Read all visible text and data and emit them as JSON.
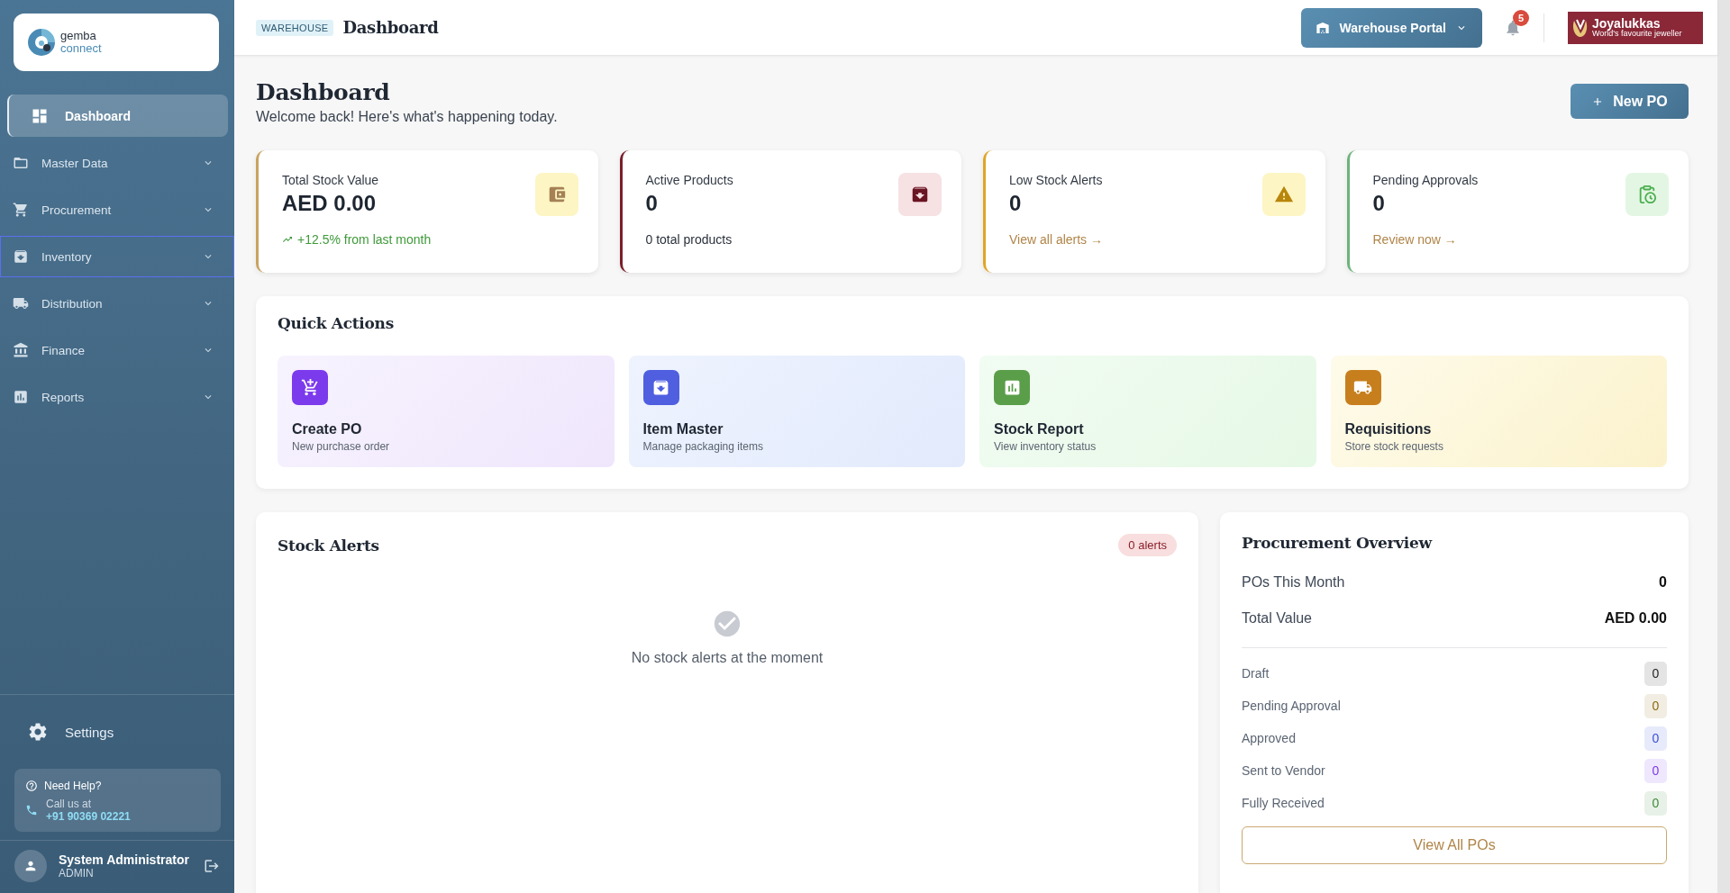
{
  "sidebar": {
    "logo": {
      "line1": "gemba",
      "line2": "connect"
    },
    "nav": [
      {
        "label": "Dashboard",
        "kind": "link",
        "selected": true,
        "focused": false
      },
      {
        "label": "Master Data",
        "kind": "group",
        "selected": false,
        "focused": false
      },
      {
        "label": "Procurement",
        "kind": "group",
        "selected": false,
        "focused": false
      },
      {
        "label": "Inventory",
        "kind": "group",
        "selected": false,
        "focused": true
      },
      {
        "label": "Distribution",
        "kind": "group",
        "selected": false,
        "focused": false
      },
      {
        "label": "Finance",
        "kind": "group",
        "selected": false,
        "focused": false
      },
      {
        "label": "Reports",
        "kind": "group",
        "selected": false,
        "focused": false
      }
    ],
    "settings": "Settings",
    "help": {
      "title": "Need Help?",
      "line": "Call us at",
      "phone": "+91 90369 02221"
    },
    "user": {
      "name": "System Administrator",
      "role": "ADMIN"
    }
  },
  "header": {
    "tag": "WAREHOUSE",
    "title": "Dashboard",
    "portal": "Warehouse Portal",
    "notifications": "5",
    "brand": {
      "name": "Joyalukkas",
      "tagline": "World's favourite jeweller"
    }
  },
  "page": {
    "title": "Dashboard",
    "subtitle": "Welcome back! Here's what's happening today.",
    "action": "New PO"
  },
  "stats": [
    {
      "label": "Total Stock Value",
      "value": "AED 0.00",
      "note": "+12.5% from last month",
      "kind": "trend",
      "color": "#c9a35f"
    },
    {
      "label": "Active Products",
      "value": "0",
      "note": "0 total products",
      "kind": "plain",
      "color": "#7a1f2b"
    },
    {
      "label": "Low Stock Alerts",
      "value": "0",
      "note": "View all alerts →",
      "kind": "link",
      "color": "#e0a526"
    },
    {
      "label": "Pending Approvals",
      "value": "0",
      "note": "Review now →",
      "kind": "link",
      "color": "#6db37c"
    }
  ],
  "quick_actions": {
    "title": "Quick Actions",
    "items": [
      {
        "title": "Create PO",
        "subtitle": "New purchase order",
        "color": "#7c3aed"
      },
      {
        "title": "Item Master",
        "subtitle": "Manage packaging items",
        "color": "#4f5fe0"
      },
      {
        "title": "Stock Report",
        "subtitle": "View inventory status",
        "color": "#5a9e4a"
      },
      {
        "title": "Requisitions",
        "subtitle": "Store stock requests",
        "color": "#c77f1e"
      }
    ]
  },
  "stock_alerts": {
    "title": "Stock Alerts",
    "badge": "0 alerts",
    "empty": "No stock alerts at the moment"
  },
  "procurement": {
    "title": "Procurement Overview",
    "summary": [
      {
        "label": "POs This Month",
        "value": "0"
      },
      {
        "label": "Total Value",
        "value": "AED 0.00"
      }
    ],
    "statuses": [
      {
        "label": "Draft",
        "value": "0",
        "color": "#222222"
      },
      {
        "label": "Pending Approval",
        "value": "0",
        "color": "#8a6a10"
      },
      {
        "label": "Approved",
        "value": "0",
        "color": "#3b4fd8"
      },
      {
        "label": "Sent to Vendor",
        "value": "0",
        "color": "#7c3aed"
      },
      {
        "label": "Fully Received",
        "value": "0",
        "color": "#3f8a3a"
      }
    ],
    "button": "View All POs"
  }
}
